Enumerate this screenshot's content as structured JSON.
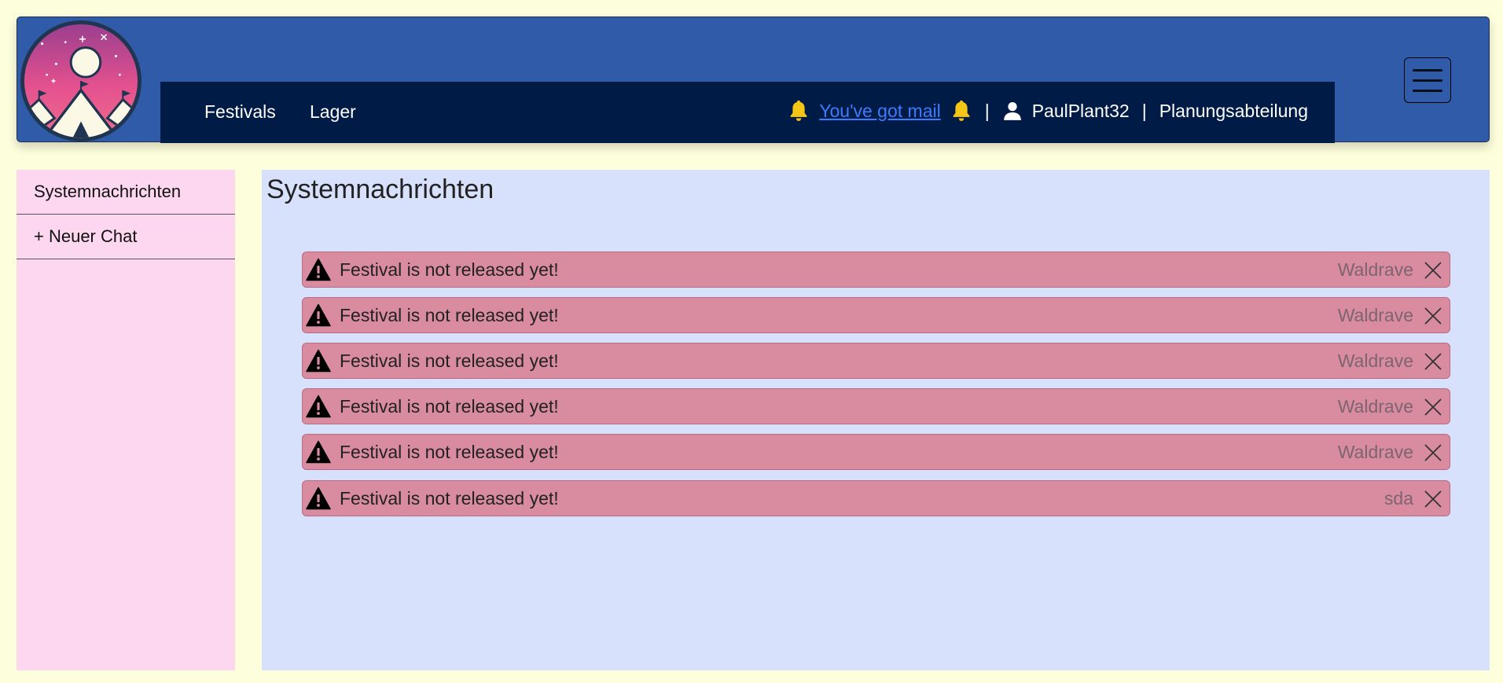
{
  "nav": {
    "links": [
      {
        "label": "Festivals"
      },
      {
        "label": "Lager"
      }
    ],
    "mail_link": "You've got mail",
    "separator_1": "|",
    "username": "PaulPlant32",
    "separator_2": "|",
    "department": "Planungsabteilung"
  },
  "sidebar": {
    "items": [
      {
        "label": "Systemnachrichten"
      },
      {
        "label": "+ Neuer Chat"
      }
    ]
  },
  "main": {
    "title": "Systemnachrichten",
    "messages": [
      {
        "text": "Festival is not released yet!",
        "festival": "Waldrave"
      },
      {
        "text": "Festival is not released yet!",
        "festival": "Waldrave"
      },
      {
        "text": "Festival is not released yet!",
        "festival": "Waldrave"
      },
      {
        "text": "Festival is not released yet!",
        "festival": "Waldrave"
      },
      {
        "text": "Festival is not released yet!",
        "festival": "Waldrave"
      },
      {
        "text": "Festival is not released yet!",
        "festival": "sda"
      }
    ]
  },
  "icons": {
    "logo": "festival-tent-moon-logo",
    "bell": "bell-icon",
    "user": "user-icon",
    "menu": "hamburger-menu-icon",
    "warning": "warning-triangle-icon",
    "close": "close-icon"
  },
  "colors": {
    "page_background": "#fdfedc",
    "header_background": "#2f5ba8",
    "nav_background": "#001b45",
    "bell_color": "#f5c518",
    "mail_link_color": "#3b7cff",
    "sidebar_background": "#fdd6ef",
    "main_background": "#d7e1fc",
    "alert_background": "#d98ba0"
  }
}
